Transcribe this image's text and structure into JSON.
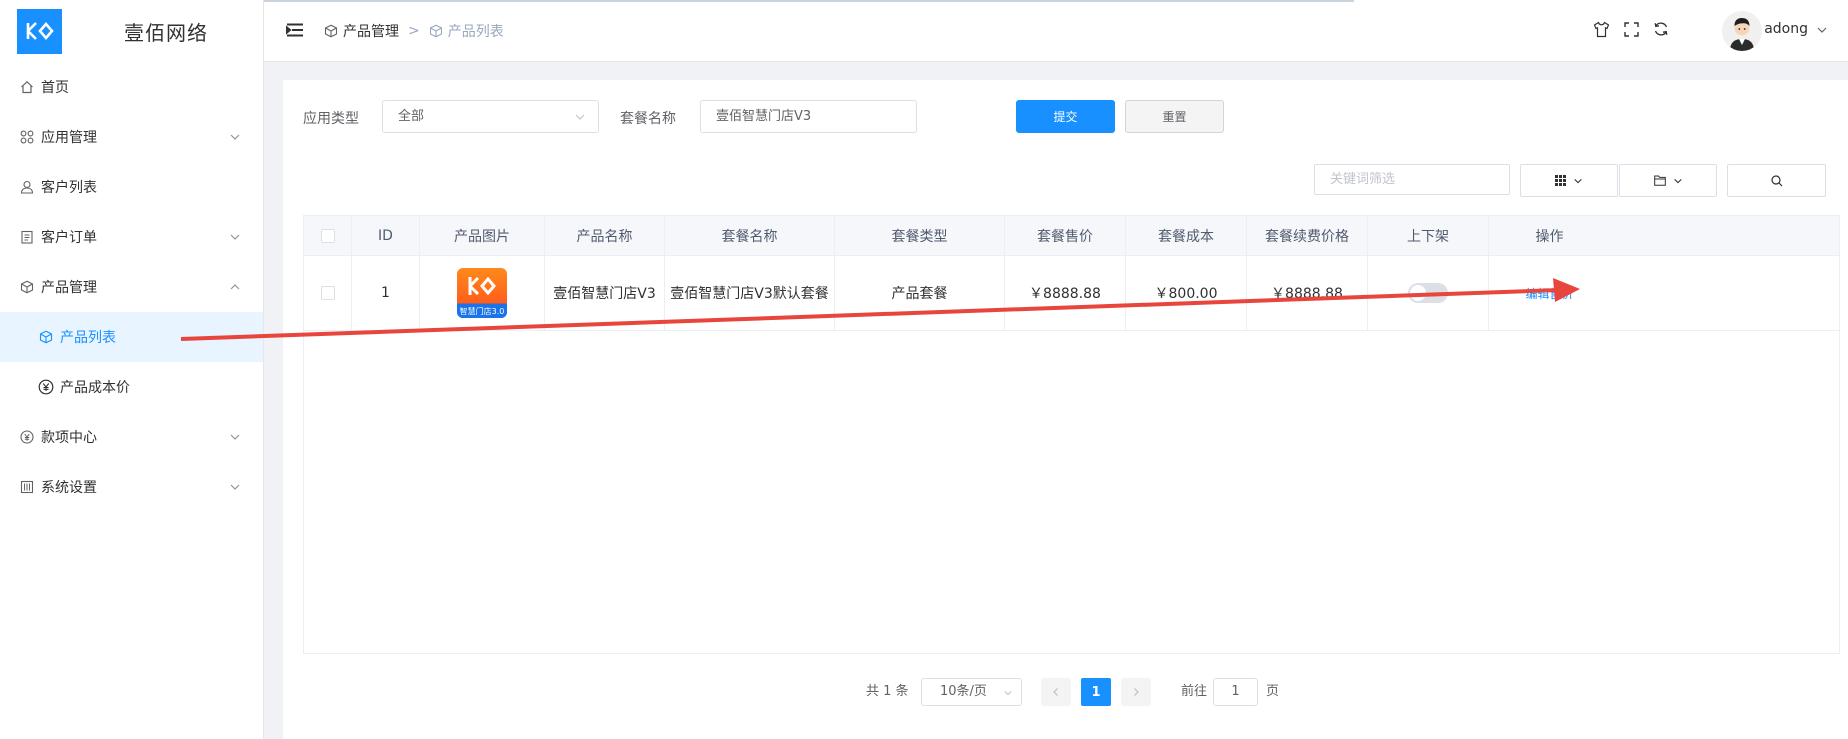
{
  "brand": {
    "title": "壹佰网络",
    "accent": "#1890ff"
  },
  "sidebar": {
    "items": [
      {
        "label": "首页",
        "icon": "home-icon"
      },
      {
        "label": "应用管理",
        "icon": "apps-icon"
      },
      {
        "label": "客户列表",
        "icon": "user-icon"
      },
      {
        "label": "客户订单",
        "icon": "order-icon"
      },
      {
        "label": "产品管理",
        "icon": "cube-icon"
      },
      {
        "label": "产品列表",
        "icon": "cube-icon"
      },
      {
        "label": "产品成本价",
        "icon": "yuan-circle-icon"
      },
      {
        "label": "款项中心",
        "icon": "yuan-icon"
      },
      {
        "label": "系统设置",
        "icon": "settings-icon"
      }
    ]
  },
  "header": {
    "breadcrumb": [
      "产品管理",
      "产品列表"
    ],
    "breadcrumb_sep": ">",
    "username": "adong",
    "icons": [
      "shirt-icon",
      "fullscreen-icon",
      "refresh-icon"
    ]
  },
  "filters": {
    "app_type_label": "应用类型",
    "app_type_value": "全部",
    "package_name_label": "套餐名称",
    "package_name_value": "壹佰智慧门店V3",
    "submit_label": "提交",
    "reset_label": "重置",
    "keyword_placeholder": "关键词筛选"
  },
  "table": {
    "columns": [
      "ID",
      "产品图片",
      "产品名称",
      "套餐名称",
      "套餐类型",
      "套餐售价",
      "套餐成本",
      "套餐续费价格",
      "上下架",
      "操作"
    ],
    "rows": [
      {
        "id": "1",
        "image_caption": "智慧门店3.0",
        "product_name": "壹佰智慧门店V3",
        "package_name": "壹佰智慧门店V3默认套餐",
        "package_type": "产品套餐",
        "price": "￥8888.88",
        "cost": "￥800.00",
        "renew_price": "￥8888.88",
        "on_shelf": false,
        "action": "编辑售价"
      }
    ]
  },
  "pagination": {
    "total": "共 1 条",
    "page_size": "10条/页",
    "current_page": "1",
    "goto_label": "前往",
    "goto_value": "1",
    "page_suffix": "页"
  }
}
